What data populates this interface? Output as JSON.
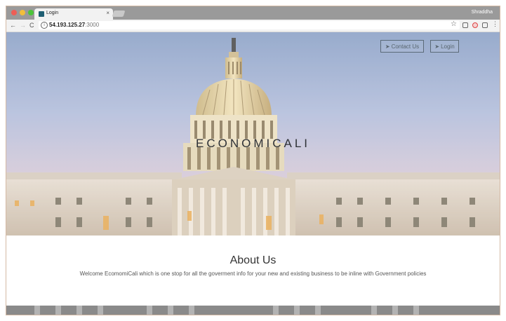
{
  "browser": {
    "tab_title": "Login",
    "tab_close": "×",
    "profile_name": "Shraddha",
    "url_host": "54.193.125.27",
    "url_port": ":3000",
    "back_icon": "←",
    "forward_icon": "→",
    "reload_icon": "C",
    "info_icon": "i",
    "star_icon": "☆",
    "menu_icon": "⋮"
  },
  "hero": {
    "contact_label": "Contact Us",
    "login_label": "Login",
    "plane_icon": "➤",
    "brand": "ECONOMICALI"
  },
  "about": {
    "heading": "About Us",
    "text": "Welcome EcomomiCali which is one stop for all the goverment info for your new and existing business to be inline with Government policies"
  },
  "colors": {
    "sky_top": "#8aa0c6",
    "button_border": "#5b6a78",
    "building": "#ddd3c8"
  }
}
